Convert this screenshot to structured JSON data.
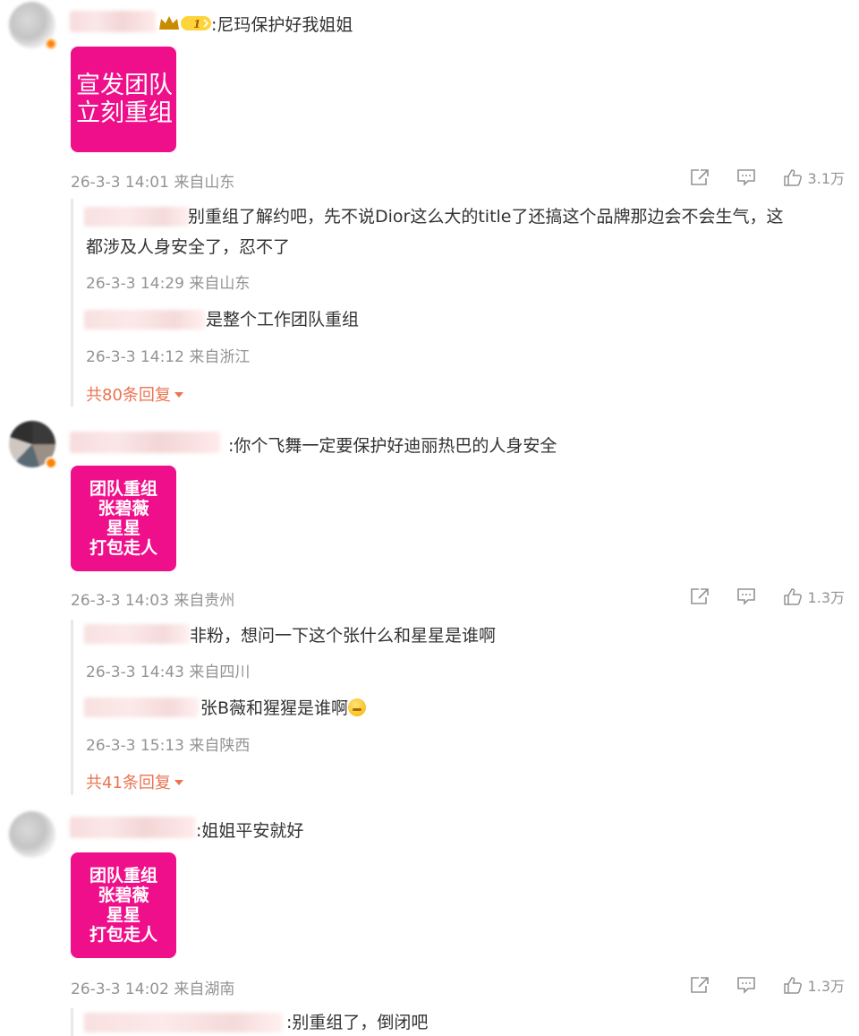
{
  "comments": [
    {
      "text": ":尼玛保护好我姐姐",
      "sticker_lines": [
        "宣发团队",
        "立刻重组"
      ],
      "time": "26-3-3 14:01",
      "location": "来自山东",
      "like_count": "3.1万",
      "badge_text": "1",
      "replies": [
        {
          "text": "别重组了解约吧，先不说Dior这么大的title了还搞这个品牌那边会不会生气，这",
          "text2": "都涉及人身安全了，忍不了",
          "time": "26-3-3 14:29",
          "location": "来自山东"
        },
        {
          "text": "是整个工作团队重组",
          "time": "26-3-3 14:12",
          "location": "来自浙江"
        }
      ],
      "more_replies": "共80条回复"
    },
    {
      "text": ":你个飞舞一定要保护好迪丽热巴的人身安全",
      "sticker_lines": [
        "团队重组",
        "张碧薇",
        "星星",
        "打包走人"
      ],
      "time": "26-3-3 14:03",
      "location": "来自贵州",
      "like_count": "1.3万",
      "replies": [
        {
          "text": "非粉，想问一下这个张什么和星星是谁啊",
          "time": "26-3-3 14:43",
          "location": "来自四川"
        },
        {
          "text": "张B薇和猩猩是谁啊",
          "time": "26-3-3 15:13",
          "location": "来自陕西"
        }
      ],
      "more_replies": "共41条回复"
    },
    {
      "text": ":姐姐平安就好",
      "sticker_lines": [
        "团队重组",
        "张碧薇",
        "星星",
        "打包走人"
      ],
      "time": "26-3-3 14:02",
      "location": "来自湖南",
      "like_count": "1.3万",
      "replies": [
        {
          "text": ":别重组了，倒闭吧"
        }
      ]
    }
  ],
  "colors": {
    "sticker": "#f00f8a",
    "link": "#eb7350",
    "meta": "#939393"
  }
}
